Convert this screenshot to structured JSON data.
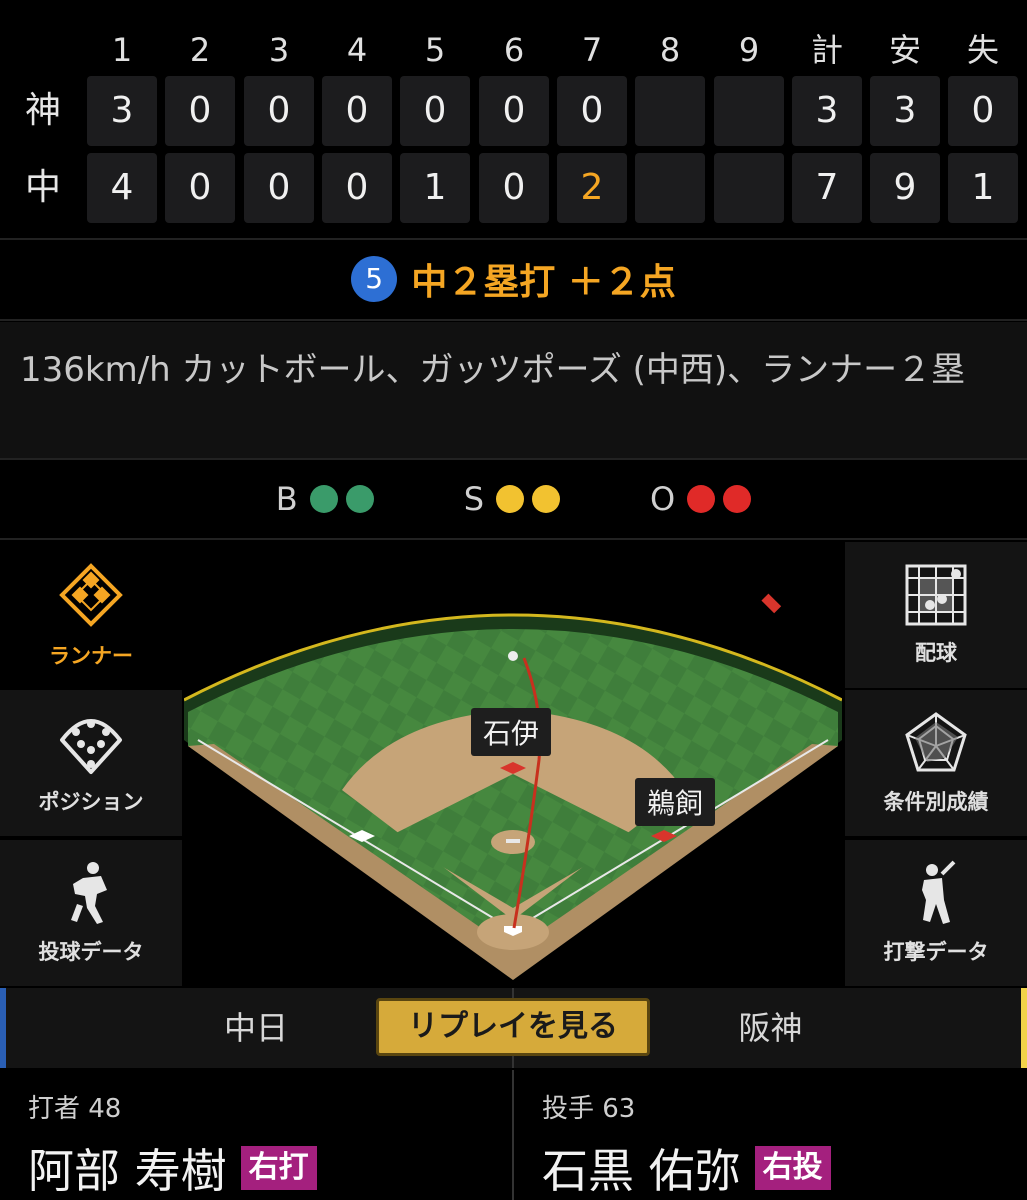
{
  "scoreboard": {
    "innings": [
      "1",
      "2",
      "3",
      "4",
      "5",
      "6",
      "7",
      "8",
      "9"
    ],
    "totals_headers": [
      "計",
      "安",
      "失"
    ],
    "teams": [
      {
        "name": "神",
        "scores": [
          "3",
          "0",
          "0",
          "0",
          "0",
          "0",
          "0",
          "",
          ""
        ],
        "totals": [
          "3",
          "3",
          "0"
        ]
      },
      {
        "name": "中",
        "scores": [
          "4",
          "0",
          "0",
          "0",
          "1",
          "0",
          "2",
          "",
          ""
        ],
        "totals": [
          "7",
          "9",
          "1"
        ]
      }
    ]
  },
  "play": {
    "number": "5",
    "title": "中２塁打 ＋２点",
    "description": "136km/h カットボール、ガッツポーズ (中西)、ランナー２塁"
  },
  "count": {
    "balls_label": "B",
    "balls": 2,
    "strikes_label": "S",
    "strikes": 2,
    "outs_label": "O",
    "outs": 2,
    "colors": {
      "ball": "#3a9b6a",
      "strike": "#f2c230",
      "out": "#e02a28"
    }
  },
  "left_menu": [
    {
      "label": "ランナー",
      "icon": "runner-diamond-icon",
      "active": true
    },
    {
      "label": "ポジション",
      "icon": "position-field-icon",
      "active": false
    },
    {
      "label": "投球データ",
      "icon": "pitcher-icon",
      "active": false
    }
  ],
  "right_menu": [
    {
      "label": "配球",
      "icon": "pitch-grid-icon"
    },
    {
      "label": "条件別成績",
      "icon": "radar-chart-icon"
    },
    {
      "label": "打撃データ",
      "icon": "batter-icon"
    }
  ],
  "field": {
    "fielders": [
      "石伊",
      "鵜飼"
    ]
  },
  "tabs": {
    "home": "中日",
    "replay": "リプレイを見る",
    "away": "阪神"
  },
  "batter": {
    "role": "打者 48",
    "name": "阿部 寿樹",
    "hand": "右打"
  },
  "pitcher": {
    "role": "投手 63",
    "name": "石黒 佑弥",
    "hand": "右投"
  }
}
